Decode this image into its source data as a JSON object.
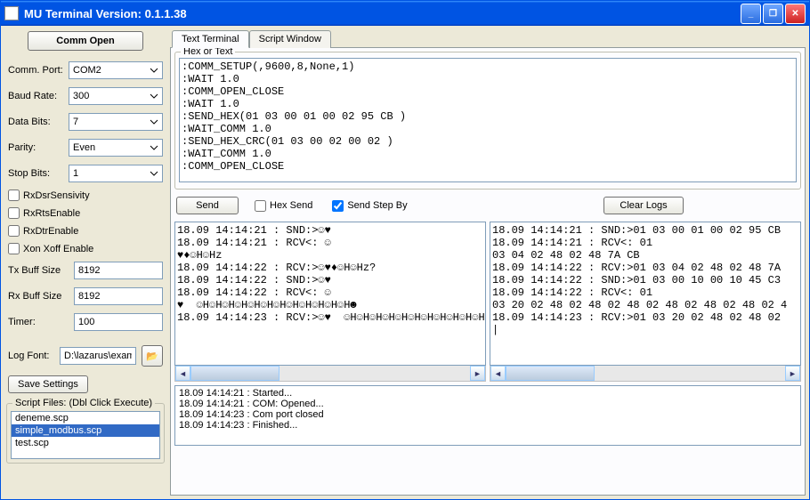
{
  "window": {
    "title": "MU Terminal Version: 0.1.1.38"
  },
  "left": {
    "comm_open_btn": "Comm Open",
    "comm_port_label": "Comm. Port:",
    "comm_port_value": "COM2",
    "baud_rate_label": "Baud Rate:",
    "baud_rate_value": "300",
    "data_bits_label": "Data Bits:",
    "data_bits_value": "7",
    "parity_label": "Parity:",
    "parity_value": "Even",
    "stop_bits_label": "Stop Bits:",
    "stop_bits_value": "1",
    "chk_rxdsr": "RxDsrSensivity",
    "chk_rxrts": "RxRtsEnable",
    "chk_rxdtr": "RxDtrEnable",
    "chk_xonxoff": "Xon Xoff Enable",
    "tx_buff_label": "Tx Buff Size",
    "tx_buff_value": "8192",
    "rx_buff_label": "Rx Buff Size",
    "rx_buff_value": "8192",
    "timer_label": "Timer:",
    "timer_value": "100",
    "log_font_label": "Log Font:",
    "log_font_value": "D:\\lazarus\\exam",
    "save_settings_btn": "Save Settings",
    "script_group_label": "Script Files: (Dbl Click Execute)",
    "script_files": [
      "deneme.scp",
      "simple_modbus.scp",
      "test.scp"
    ],
    "script_selected": 1
  },
  "tabs": {
    "text_terminal": "Text Terminal",
    "script_window": "Script Window"
  },
  "hex_group_label": "Hex or Text",
  "script_text": ":COMM_SETUP(,9600,8,None,1)\n:WAIT 1.0\n:COMM_OPEN_CLOSE\n:WAIT 1.0\n:SEND_HEX(01 03 00 01 00 02 95 CB )\n:WAIT_COMM 1.0\n:SEND_HEX_CRC(01 03 00 02 00 02 )\n:WAIT_COMM 1.0\n:COMM_OPEN_CLOSE",
  "actions": {
    "send_btn": "Send",
    "hex_send_chk": "Hex Send",
    "send_step_chk": "Send Step By",
    "send_step_checked": true,
    "clear_logs_btn": "Clear Logs"
  },
  "log_left": "18.09 14:14:21 : SND:>☺♥\n18.09 14:14:21 : RCV<: ☺\n♥♦☺H☺Hz\n18.09 14:14:22 : RCV:>☺♥♦☺H☺Hz?\n18.09 14:14:22 : SND:>☺♥\n18.09 14:14:22 : RCV<: ☺\n♥  ☺H☺H☺H☺H☺H☺H☺H☺H☺H☺H☺H☺H☻\n18.09 14:14:23 : RCV:>☺♥  ☺H☺H☺H☺H☺H☺H☺H☺H☺H☺H☺H",
  "log_right": "18.09 14:14:21 : SND:>01 03 00 01 00 02 95 CB\n18.09 14:14:21 : RCV<: 01\n03 04 02 48 02 48 7A CB\n18.09 14:14:22 : RCV:>01 03 04 02 48 02 48 7A\n18.09 14:14:22 : SND:>01 03 00 10 00 10 45 C3\n18.09 14:14:22 : RCV<: 01\n03 20 02 48 02 48 02 48 02 48 02 48 02 48 02 4\n18.09 14:14:23 : RCV:>01 03 20 02 48 02 48 02\n|",
  "status_log": "18.09 14:14:21 : Started...\n18.09 14:14:21 : COM: Opened...\n18.09 14:14:23 : Com port closed\n18.09 14:14:23 : Finished..."
}
